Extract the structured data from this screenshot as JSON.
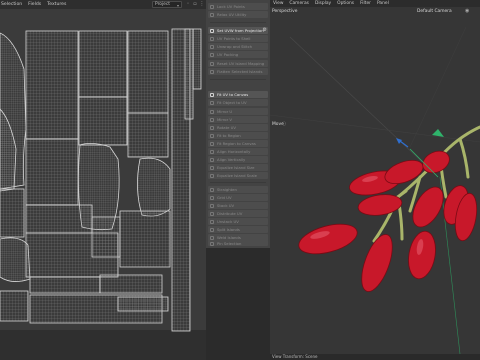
{
  "uv_editor": {
    "menu": [
      "Selection",
      "Fields",
      "Textures"
    ],
    "project_select": "Project"
  },
  "palette": {
    "items": [
      {
        "label": "Lock UV Points",
        "active": false
      },
      {
        "label": "Relax UV Utility",
        "active": false
      },
      {
        "label": "Set UVW from Projection",
        "active": true
      },
      {
        "label": "UV Points to Shell",
        "active": false
      },
      {
        "label": "Unwrap and Stitch",
        "active": false
      },
      {
        "label": "UV Packing",
        "active": false
      },
      {
        "label": "Reset UV Island Mapping",
        "active": false
      },
      {
        "label": "Flatten Selected Islands",
        "active": false
      },
      {
        "label": "Fit UV to Canvas",
        "active": true
      },
      {
        "label": "Fit Object to UV",
        "active": false
      },
      {
        "label": "Mirror U",
        "active": false
      },
      {
        "label": "Mirror V",
        "active": false
      },
      {
        "label": "Rotate UV",
        "active": false
      },
      {
        "label": "Fit to Region",
        "active": false
      },
      {
        "label": "Fit Region to Canvas",
        "active": false
      },
      {
        "label": "Align Horizontally",
        "active": false
      },
      {
        "label": "Align Vertically",
        "active": false
      },
      {
        "label": "Equalize Island Size",
        "active": false
      },
      {
        "label": "Equalize Island Scale",
        "active": false
      },
      {
        "label": "Straighten",
        "active": false
      },
      {
        "label": "Grid UV",
        "active": false
      },
      {
        "label": "Stack UV",
        "active": false
      },
      {
        "label": "Distribute UV",
        "active": false
      },
      {
        "label": "Unstack UV",
        "active": false
      },
      {
        "label": "Split Islands",
        "active": false
      },
      {
        "label": "Weld Islands",
        "active": false
      },
      {
        "label": "Pin Selection",
        "active": false
      },
      {
        "label": "Unpin Selection",
        "active": false
      },
      {
        "label": "Unpin All",
        "active": false
      },
      {
        "label": "Sew Edges",
        "active": false
      }
    ]
  },
  "viewport": {
    "menu": [
      "View",
      "Cameras",
      "Display",
      "Options",
      "Filter",
      "Panel"
    ],
    "perspective_label": "Perspective",
    "camera_label": "Default Camera",
    "move_label": "Move",
    "status": "View Transform: Scene"
  },
  "colors": {
    "berry": "#c8182a",
    "berry_dark": "#7a0a14",
    "stem": "#a9b56a",
    "uv_line": "#d8d8d8",
    "uv_grid": "#8f8f8f",
    "gizmo_green": "#2fb36b",
    "gizmo_blue": "#2f6fd0"
  }
}
